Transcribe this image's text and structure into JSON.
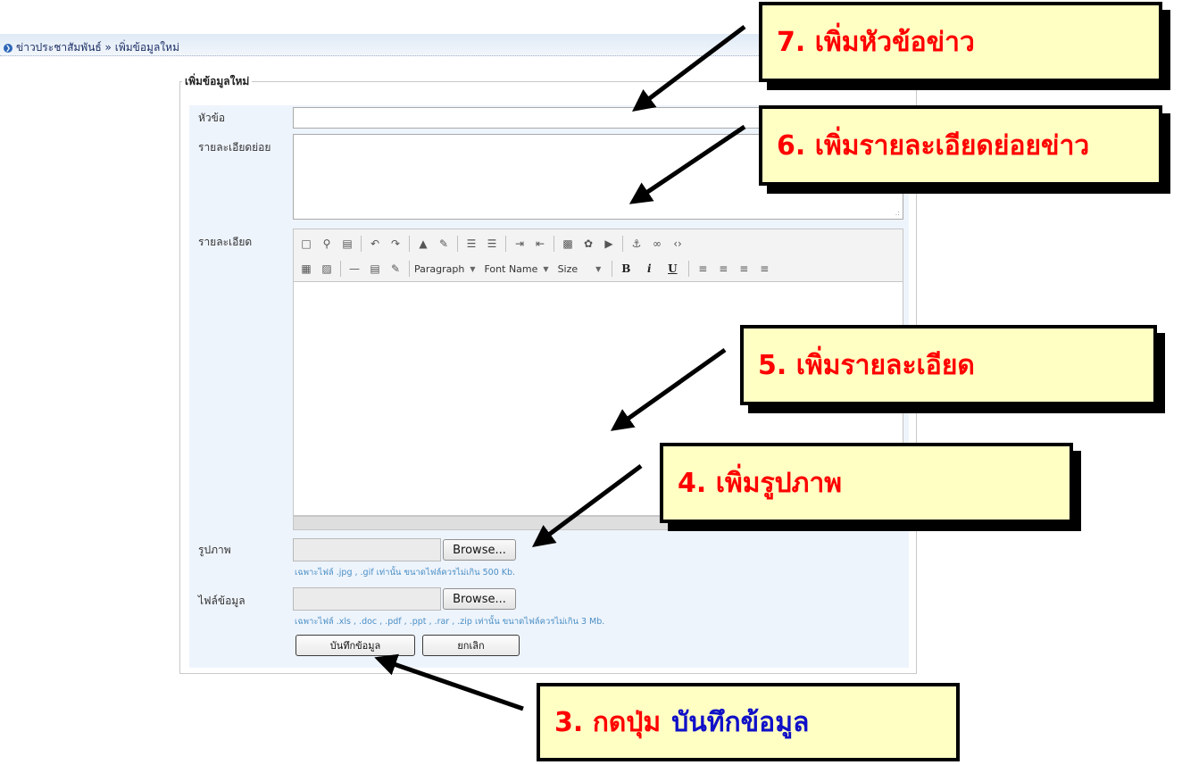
{
  "breadcrumb": {
    "text": "ข่าวประชาสัมพันธ์ » เพิ่มข้อมูลใหม่",
    "icon": "chevron-circle-icon"
  },
  "form": {
    "legend": "เพิ่มข้อมูลใหม่",
    "title_label": "หัวข้อ",
    "summary_label": "รายละเอียดย่อย",
    "detail_label": "รายละเอียด",
    "image_label": "รูปภาพ",
    "file_label": "ไฟล์ข้อมูล",
    "browse_label": "Browse...",
    "image_hint": "เฉพาะไฟล์ .jpg , .gif เท่านั้น ขนาดไฟล์ควรไม่เกิน 500 Kb.",
    "file_hint": "เฉพาะไฟล์ .xls , .doc , .pdf , .ppt , .rar , .zip เท่านั้น ขนาดไฟล์ควรไม่เกิน 3 Mb.",
    "save_label": "บันทึกข้อมูล",
    "cancel_label": "ยกเลิก"
  },
  "editor": {
    "format_dropdown": "Paragraph",
    "font_dropdown": "Font Name",
    "size_dropdown": "Size",
    "bold": "B",
    "italic": "i",
    "underline": "U"
  },
  "callouts": {
    "step7": "7. เพิ่มหัวข้อข่าว",
    "step6": "6. เพิ่มรายละเอียดย่อยข่าว",
    "step5": "5. เพิ่มรายละเอียด",
    "step4": "4. เพิ่มรูปภาพ",
    "step3_prefix": "3. กดปุ่ม",
    "step3_button": "บันทึกข้อมูล"
  },
  "colors": {
    "callout_bg": "#ffffc4",
    "callout_text": "#ff0000",
    "callout_button_text": "#1010c8",
    "panel_bg": "#eef4fc"
  }
}
